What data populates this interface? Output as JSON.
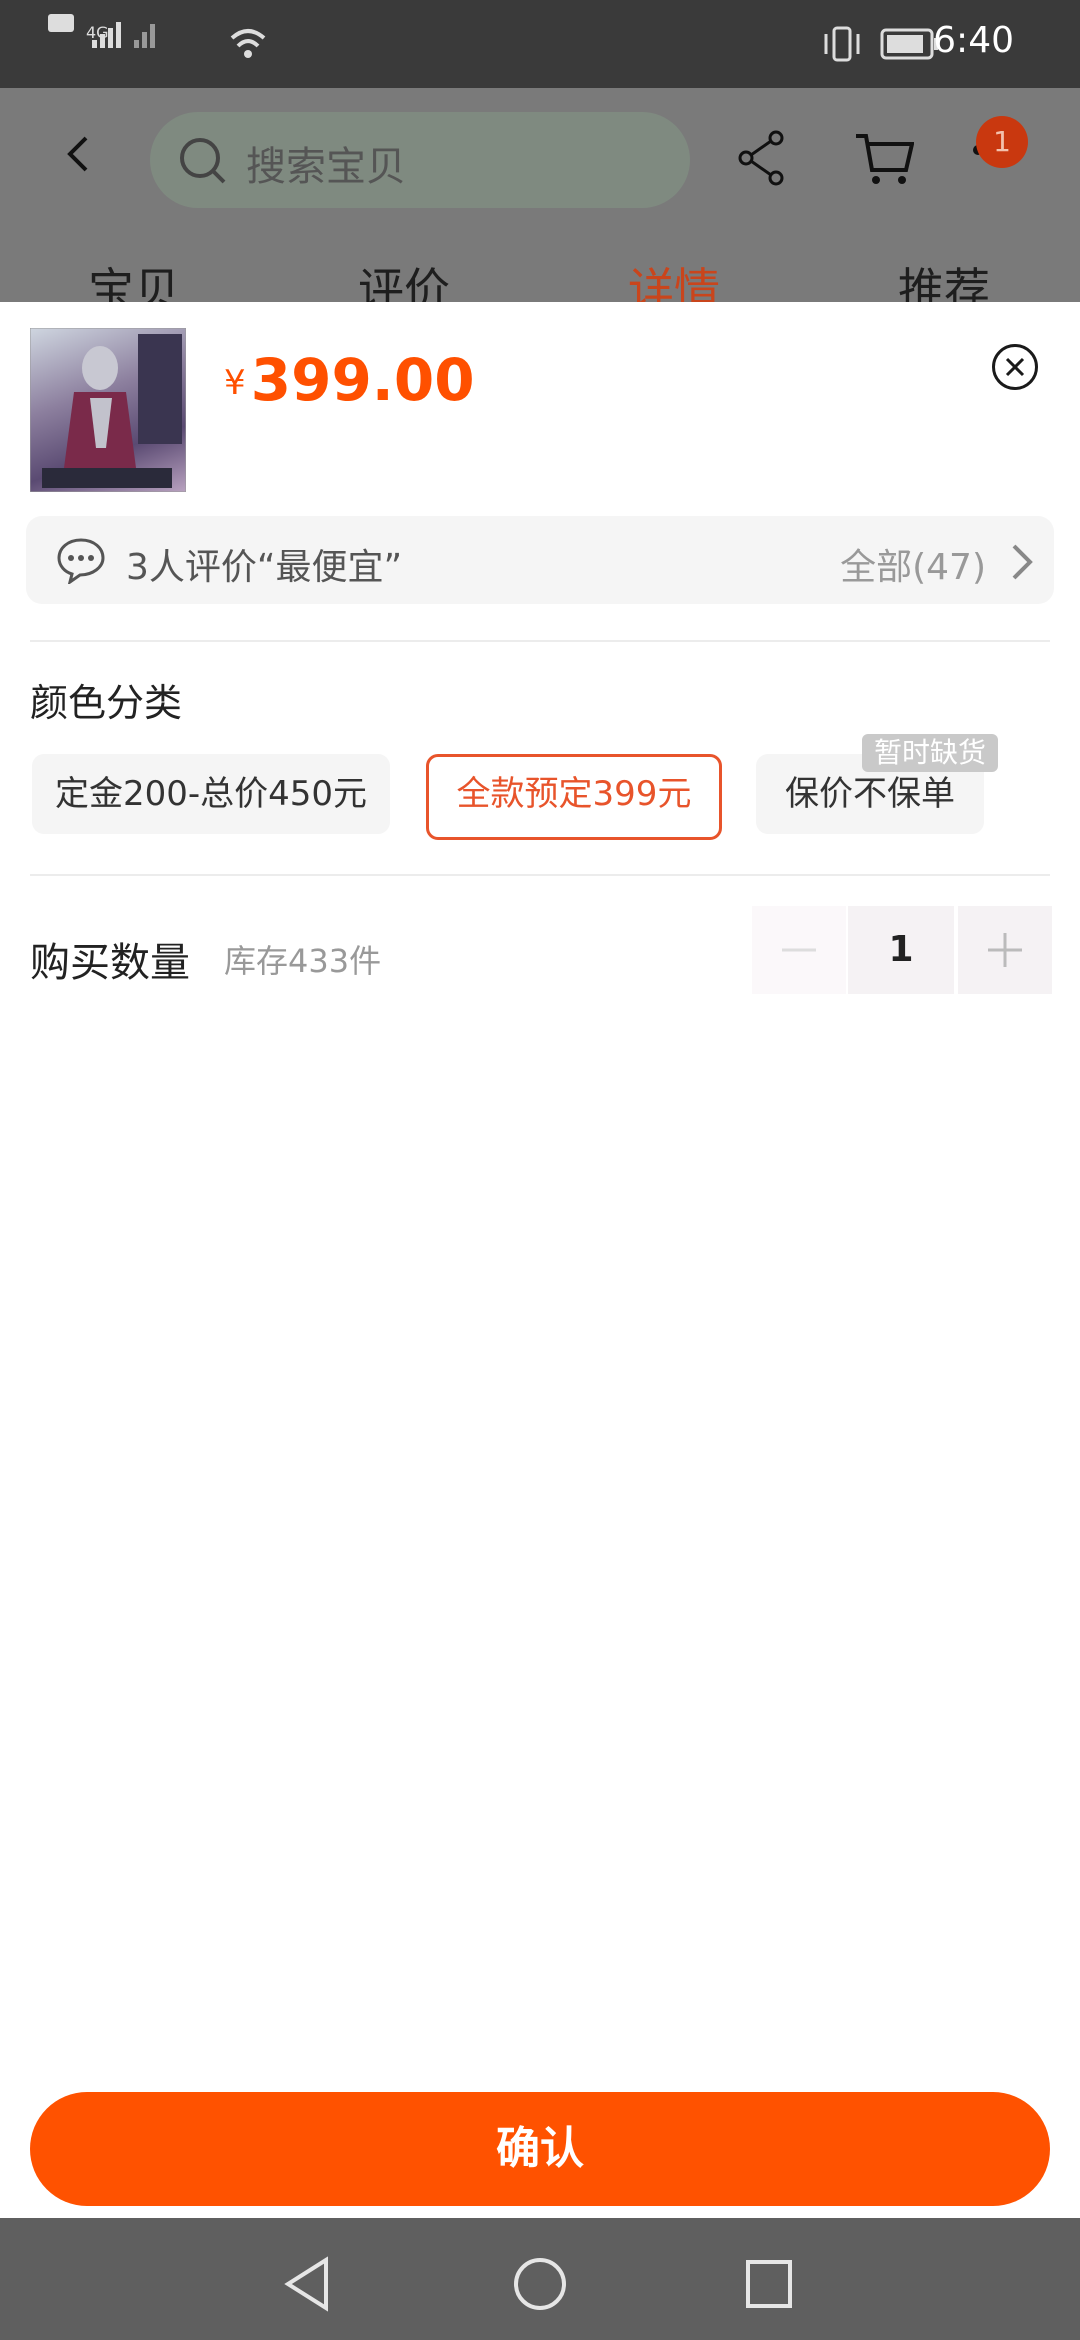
{
  "status_bar": {
    "time": "6:40",
    "network": "4G"
  },
  "header": {
    "search_placeholder": "搜索宝贝",
    "cart_badge": "1",
    "tabs": [
      {
        "label": "宝贝",
        "active": false
      },
      {
        "label": "评价",
        "active": false
      },
      {
        "label": "详情",
        "active": true
      },
      {
        "label": "推荐",
        "active": false
      }
    ]
  },
  "sheet": {
    "currency_symbol": "¥",
    "price": "399.00",
    "review_summary": "3人评价“最便宜”",
    "review_all": "全部(47)",
    "color_title": "颜色分类",
    "options": [
      {
        "label": "定金200-总价450元",
        "selected": false
      },
      {
        "label": "全款预定399元",
        "selected": true
      },
      {
        "label": "保价不保单",
        "selected": false,
        "badge": "暂时缺货"
      }
    ],
    "qty_title": "购买数量",
    "stock": "库存433件",
    "quantity": "1",
    "confirm_label": "确认"
  },
  "colors": {
    "accent": "#ff5000",
    "selected_border": "#e8542b"
  }
}
